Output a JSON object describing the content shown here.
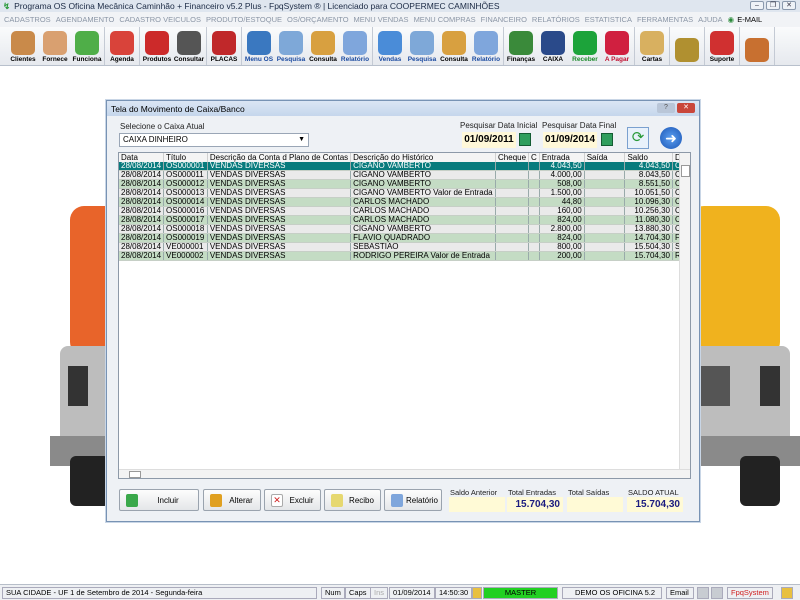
{
  "window": {
    "title": "Programa OS Oficina Mecânica Caminhão + Financeiro v5.2 Plus - FpqSystem ® | Licenciado para  COOPERMEC CAMINHÕES"
  },
  "menu": [
    "CADASTROS",
    "AGENDAMENTO",
    "CADASTRO VEICULOS",
    "PRODUTO/ESTOQUE",
    "OS/ORÇAMENTO",
    "MENU VENDAS",
    "MENU COMPRAS",
    "FINANCEIRO",
    "RELATÓRIOS",
    "ESTATISTICA",
    "FERRAMENTAS",
    "AJUDA"
  ],
  "menu_email": "E-MAIL",
  "toolbar": [
    {
      "label": "Clientes",
      "icon": "clients-icon",
      "color": "#c98a4a"
    },
    {
      "label": "Fornece",
      "icon": "supplier-icon",
      "color": "#d9a070"
    },
    {
      "label": "Funciona",
      "icon": "employee-icon",
      "color": "#4fae48"
    },
    {
      "label": "Agenda",
      "icon": "calendar-icon",
      "color": "#d9433a"
    },
    {
      "label": "Produtos",
      "icon": "toolbox-icon",
      "color": "#cc2a2a"
    },
    {
      "label": "Consultar",
      "icon": "barcode-icon",
      "color": "#555"
    },
    {
      "label": "PLACAS",
      "icon": "truck-icon",
      "color": "#c0282a"
    },
    {
      "label": "Menu OS",
      "icon": "clipboard-icon",
      "color": "#3a78c0"
    },
    {
      "label": "Pesquisa",
      "icon": "search-doc-icon",
      "color": "#7ea8d8"
    },
    {
      "label": "Consulta",
      "icon": "drawer-icon",
      "color": "#d8a040"
    },
    {
      "label": "Relatório",
      "icon": "printer-icon",
      "color": "#7fa6dc"
    },
    {
      "label": "Vendas",
      "icon": "monitor-icon",
      "color": "#4a8cd8"
    },
    {
      "label": "Pesquisa",
      "icon": "search-doc-icon",
      "color": "#7ea8d8"
    },
    {
      "label": "Consulta",
      "icon": "drawer-icon",
      "color": "#d8a040"
    },
    {
      "label": "Relatório",
      "icon": "printer-icon",
      "color": "#7fa6dc"
    },
    {
      "label": "Finanças",
      "icon": "finance-pie-icon",
      "color": "#3a8a3a"
    },
    {
      "label": "CAIXA",
      "icon": "cash-book-icon",
      "color": "#2a4a8a"
    },
    {
      "label": "Receber",
      "icon": "dollar-green-icon",
      "color": "#1ca33a"
    },
    {
      "label": "A Pagar",
      "icon": "dollar-red-icon",
      "color": "#d02040"
    },
    {
      "label": "Cartas",
      "icon": "scroll-icon",
      "color": "#d8b060"
    },
    {
      "label": "",
      "icon": "coins-icon",
      "color": "#b09030"
    },
    {
      "label": "Suporte",
      "icon": "support-icon",
      "color": "#d03030"
    },
    {
      "label": "",
      "icon": "exit-icon",
      "color": "#c87030"
    }
  ],
  "dialog": {
    "title": "Tela do Movimento de Caixa/Banco",
    "caixa_label": "Selecione o Caixa Atual",
    "caixa_value": "CAIXA DINHEIRO",
    "date_start_label": "Pesquisar Data Inicial",
    "date_start": "01/09/2011",
    "date_end_label": "Pesquisar Data Final",
    "date_end": "01/09/2014",
    "columns": [
      "Data",
      "Título",
      "Descrição da Conta d Plano de Contas",
      "Descrição do Histórico",
      "Cheque",
      "C",
      "Entrada",
      "Saída",
      "Saldo",
      "D"
    ],
    "rows": [
      [
        "28/08/2014",
        "OS000001",
        "VENDAS DIVERSAS",
        "CIGANO VAMBERTO",
        "",
        "",
        "4.043,50",
        "",
        "4.043,50",
        "CI"
      ],
      [
        "28/08/2014",
        "OS000011",
        "VENDAS DIVERSAS",
        "CIGANO VAMBERTO",
        "",
        "",
        "4.000,00",
        "",
        "8.043,50",
        "CI"
      ],
      [
        "28/08/2014",
        "OS000012",
        "VENDAS DIVERSAS",
        "CIGANO VAMBERTO",
        "",
        "",
        "508,00",
        "",
        "8.551,50",
        "CI"
      ],
      [
        "28/08/2014",
        "OS000013",
        "VENDAS DIVERSAS",
        "CIGANO VAMBERTO Valor de Entrada",
        "",
        "",
        "1.500,00",
        "",
        "10.051,50",
        "CI"
      ],
      [
        "28/08/2014",
        "OS000014",
        "VENDAS DIVERSAS",
        "CARLOS MACHADO",
        "",
        "",
        "44,80",
        "",
        "10.096,30",
        "CA"
      ],
      [
        "28/08/2014",
        "OS000016",
        "VENDAS DIVERSAS",
        "CARLOS MACHADO",
        "",
        "",
        "160,00",
        "",
        "10.256,30",
        "CA"
      ],
      [
        "28/08/2014",
        "OS000017",
        "VENDAS DIVERSAS",
        "CARLOS MACHADO",
        "",
        "",
        "824,00",
        "",
        "11.080,30",
        "CA"
      ],
      [
        "28/08/2014",
        "OS000018",
        "VENDAS DIVERSAS",
        "CIGANO VAMBERTO",
        "",
        "",
        "2.800,00",
        "",
        "13.880,30",
        "CI"
      ],
      [
        "28/08/2014",
        "OS000019",
        "VENDAS DIVERSAS",
        "FLÁVIO QUADRADO",
        "",
        "",
        "824,00",
        "",
        "14.704,30",
        "FL"
      ],
      [
        "28/08/2014",
        "VE000001",
        "VENDAS DIVERSAS",
        "SEBASTIÃO",
        "",
        "",
        "800,00",
        "",
        "15.504,30",
        "SE"
      ],
      [
        "28/08/2014",
        "VE000002",
        "VENDAS DIVERSAS",
        "RODRIGO PEREIRA Valor de Entrada",
        "",
        "",
        "200,00",
        "",
        "15.704,30",
        "RO"
      ]
    ],
    "buttons": {
      "incluir": "Incluir",
      "alterar": "Alterar",
      "excluir": "Excluir",
      "recibo": "Recibo",
      "relatorio": "Relatório"
    },
    "totals": {
      "saldo_anterior_label": "Saldo Anterior",
      "saldo_anterior": "",
      "total_entradas_label": "Total Entradas",
      "total_entradas": "15.704,30",
      "total_saidas_label": "Total Saídas",
      "total_saidas": "",
      "saldo_atual_label": "SALDO ATUAL",
      "saldo_atual": "15.704,30"
    }
  },
  "statusbar": {
    "location_date": "SUA CIDADE - UF  1 de Setembro de 2014 - Segunda-feira",
    "num": "Num",
    "caps": "Caps",
    "ins": "Ins",
    "date": "01/09/2014",
    "time": "14:50:30",
    "user": "MASTER",
    "version": "DEMO OS OFICINA 5.2",
    "email": "Email",
    "brand": "FpqSystem"
  },
  "colors": {
    "selected_row": "#087b7d",
    "alt_row": "#c4dcc4",
    "user_badge": "#22d022"
  }
}
